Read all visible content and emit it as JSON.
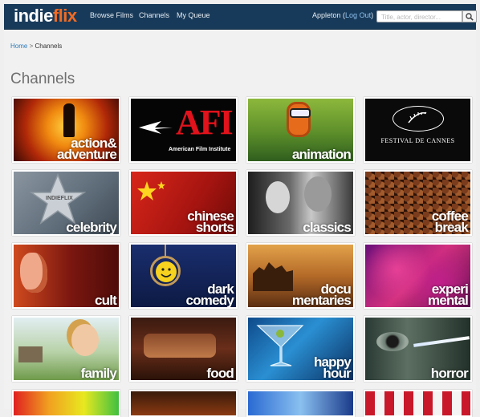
{
  "header": {
    "logo_part1": "indie",
    "logo_part2": "flix",
    "nav": [
      "Browse Films",
      "Channels",
      "My Queue"
    ],
    "user": "Appleton",
    "logout_label": "Log Out",
    "search_placeholder": "Title, actor, director..."
  },
  "breadcrumb": {
    "home": "Home",
    "separator": ">",
    "current": "Channels"
  },
  "page_title": "Channels",
  "channels": [
    {
      "label": "action & adventure",
      "lines": [
        "action&",
        "adventure"
      ]
    },
    {
      "label": "AFI",
      "logo": "AFI",
      "subtitle": "American Film Institute"
    },
    {
      "label": "animation",
      "lines": [
        "animation"
      ]
    },
    {
      "label": "Festival de Cannes",
      "logo": "FESTIVAL DE CANNES"
    },
    {
      "label": "celebrity",
      "lines": [
        "celebrity"
      ],
      "watermark": "INDIEFLIX"
    },
    {
      "label": "chinese shorts",
      "lines": [
        "chinese",
        "shorts"
      ]
    },
    {
      "label": "classics",
      "lines": [
        "classics"
      ]
    },
    {
      "label": "coffee break",
      "lines": [
        "coffee",
        "break"
      ]
    },
    {
      "label": "cult",
      "lines": [
        "cult"
      ]
    },
    {
      "label": "dark comedy",
      "lines": [
        "dark",
        "comedy"
      ]
    },
    {
      "label": "documentaries",
      "lines": [
        "docu",
        "mentaries"
      ]
    },
    {
      "label": "experimental",
      "lines": [
        "experi",
        "mental"
      ]
    },
    {
      "label": "family",
      "lines": [
        "family"
      ]
    },
    {
      "label": "food",
      "lines": [
        "food"
      ]
    },
    {
      "label": "happy hour",
      "lines": [
        "happy",
        "hour"
      ]
    },
    {
      "label": "horror",
      "lines": [
        "horror"
      ]
    }
  ]
}
